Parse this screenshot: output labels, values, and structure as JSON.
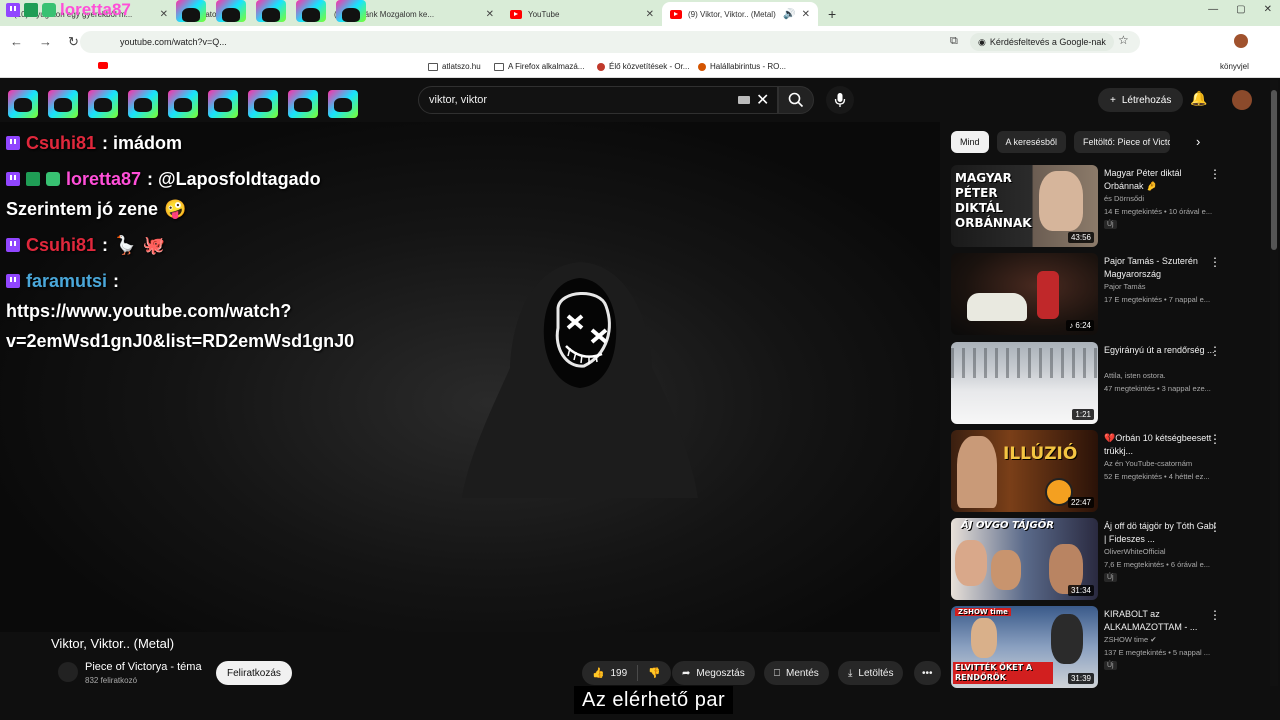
{
  "browser": {
    "tabs": [
      {
        "title": "loretta87",
        "active": false
      },
      {
        "title": "(10) Nyugaton egy gyerekből m...",
        "active": false
      },
      {
        "title": "(10) Iratok SZA...",
        "active": false
      },
      {
        "title": "(10) Hazánk Mozgalom ke...",
        "active": false
      },
      {
        "title": "YouTube",
        "active": false
      },
      {
        "title": "(9) Viktor, Viktor.. (Metal) -",
        "active": true
      }
    ],
    "new_tab": "+",
    "address": "youtube.com/watch?v=Q...",
    "google_ask": "Kérdésfeltevés a Google-nak",
    "bookmarks": [
      {
        "label": "loretta87",
        "icon": "youtube"
      },
      {
        "label": "atlatszo.hu",
        "icon": "folder"
      },
      {
        "label": "A Firefox alkalmazá...",
        "icon": "folder"
      },
      {
        "label": "Élő közvetítések - Or...",
        "icon": "dot"
      },
      {
        "label": "Halállabirintus - RO...",
        "icon": "dot"
      }
    ],
    "other_bookmarks": "könyvjel"
  },
  "youtube": {
    "search_value": "viktor, viktor",
    "create_label": "Létrehozás",
    "video_title": "Viktor, Viktor.. (Metal)",
    "channel": "Piece of Victorya - téma",
    "subscribers": "832 feliratkozó",
    "subscribe_label": "Feliratkozás",
    "likes": "199",
    "share_label": "Megosztás",
    "save_label": "Mentés",
    "download_label": "Letöltés",
    "caption": "Az elérhető par",
    "chips": [
      "Mind",
      "A keresésből",
      "Feltöltő: Piece of Victo"
    ],
    "recommendations": [
      {
        "title": "Magyar Péter diktál Orbánnak 🤌",
        "channel": "és Dörnsődi",
        "meta": "14 E megtekintés • 10 órával e...",
        "badge": "Új",
        "duration": "43:56"
      },
      {
        "title": "Pajor Tamás - Szuterén Magyarország",
        "channel": "Pajor Tamás",
        "meta": "17 E megtekintés • 7 nappal e...",
        "badge": "",
        "duration": "6:24"
      },
      {
        "title": "Egyirányú út a rendőrség ...",
        "channel": "Attila, isten ostora.",
        "meta": "47 megtekintés • 3 nappal eze...",
        "badge": "",
        "duration": "1:21"
      },
      {
        "title": "💔Orbán 10 kétségbeesett trükkj...",
        "channel": "Az én YouTube-csatornám",
        "meta": "52 E megtekintés • 4 héttel ez...",
        "badge": "",
        "duration": "22:47"
      },
      {
        "title": "Áj off dö tájgör by Tóth Gabi | Fideszes ...",
        "channel": "OliverWhiteOfficial",
        "meta": "7,6 E megtekintés • 6 órával e...",
        "badge": "Új",
        "duration": "31:34"
      },
      {
        "title": "KIRABOLT az ALKALMAZOTTAM - ...",
        "channel": "ZSHOW time",
        "meta": "137 E megtekintés • 5 nappal ...",
        "badge": "Új",
        "duration": "31:39"
      }
    ],
    "thumb_texts": {
      "t1": "MAGYAR PÉTER DIKTÁL ORBÁNNAK",
      "t4": "ILLÚZIÓ",
      "t5": "ÁJ OVGO TÁJGÖR",
      "t6a": "ZSHOW time",
      "t6b": "ELVITTÉK ŐKET A RENDŐRÖK"
    }
  },
  "chat": {
    "messages": [
      {
        "user": "Csuhi81",
        "text": ": imádom"
      },
      {
        "user": "loretta87",
        "text": ": @Laposfoldtagado",
        "text2": "Szerintem jó zene"
      },
      {
        "user": "Csuhi81",
        "text": ":"
      },
      {
        "user": "faramutsi",
        "text": ":",
        "text2": "https://www.youtube.com/watch?",
        "text3": "v=2emWsd1gnJ0&list=RD2emWsd1gnJ0"
      }
    ],
    "overlay_user": "loretta87"
  },
  "colors": {
    "accent": "#ff0000",
    "twitch": "#9146ff",
    "bg": "#0f0f0f"
  }
}
